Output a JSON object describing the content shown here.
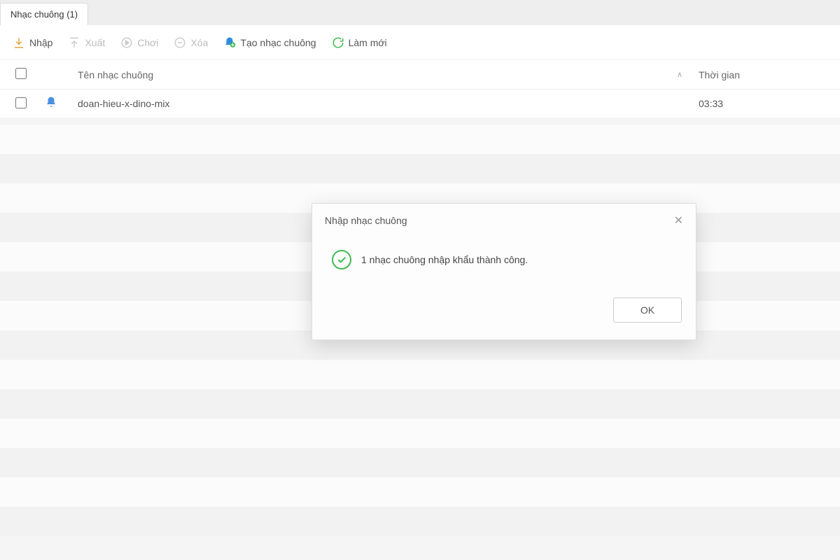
{
  "tab": {
    "label": "Nhạc chuông (1)"
  },
  "toolbar": {
    "import": "Nhập",
    "export": "Xuất",
    "play": "Chơi",
    "delete": "Xóa",
    "create": "Tạo nhạc chuông",
    "refresh": "Làm mới"
  },
  "headers": {
    "name": "Tên nhạc chuông",
    "time": "Thời gian",
    "sort_indicator": "∧"
  },
  "rows": [
    {
      "name": "doan-hieu-x-dino-mix",
      "time": "03:33"
    }
  ],
  "modal": {
    "title": "Nhập nhạc chuông",
    "message": "1 nhạc chuông nhập khẩu thành công.",
    "ok": "OK"
  },
  "icons": {
    "import": "import-icon",
    "export": "export-icon",
    "play": "play-icon",
    "delete": "delete-icon",
    "bell": "bell-icon",
    "refresh": "refresh-icon",
    "close": "close-icon",
    "check": "check-icon"
  }
}
